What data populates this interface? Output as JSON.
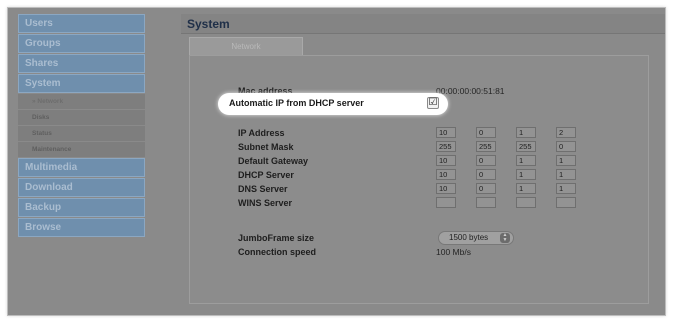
{
  "sidebar": {
    "items": [
      {
        "label": "Users"
      },
      {
        "label": "Groups"
      },
      {
        "label": "Shares"
      },
      {
        "label": "System"
      }
    ],
    "subitems": [
      {
        "label": "» Network"
      },
      {
        "label": "Disks"
      },
      {
        "label": "Status"
      },
      {
        "label": "Maintenance"
      }
    ],
    "items_after": [
      {
        "label": "Multimedia"
      },
      {
        "label": "Download"
      },
      {
        "label": "Backup"
      },
      {
        "label": "Browse"
      }
    ]
  },
  "main": {
    "title": "System",
    "tab": "Network",
    "mac_label": "Mac address",
    "mac_value": "00:00:00:00:51:81",
    "dhcp_label": "Automatic IP from DHCP server",
    "dhcp_checked": "☑",
    "fields": [
      {
        "label": "IP Address",
        "octets": [
          "10",
          "0",
          "1",
          "2"
        ]
      },
      {
        "label": "Subnet Mask",
        "octets": [
          "255",
          "255",
          "255",
          "0"
        ]
      },
      {
        "label": "Default Gateway",
        "octets": [
          "10",
          "0",
          "1",
          "1"
        ]
      },
      {
        "label": "DHCP Server",
        "octets": [
          "10",
          "0",
          "1",
          "1"
        ]
      },
      {
        "label": "DNS Server",
        "octets": [
          "10",
          "0",
          "1",
          "1"
        ]
      },
      {
        "label": "WINS Server",
        "octets": [
          "",
          "",
          "",
          ""
        ]
      }
    ],
    "jumbo_label": "JumboFrame size",
    "jumbo_value": "1500 bytes",
    "speed_label": "Connection speed",
    "speed_value": "100 Mb/s"
  }
}
